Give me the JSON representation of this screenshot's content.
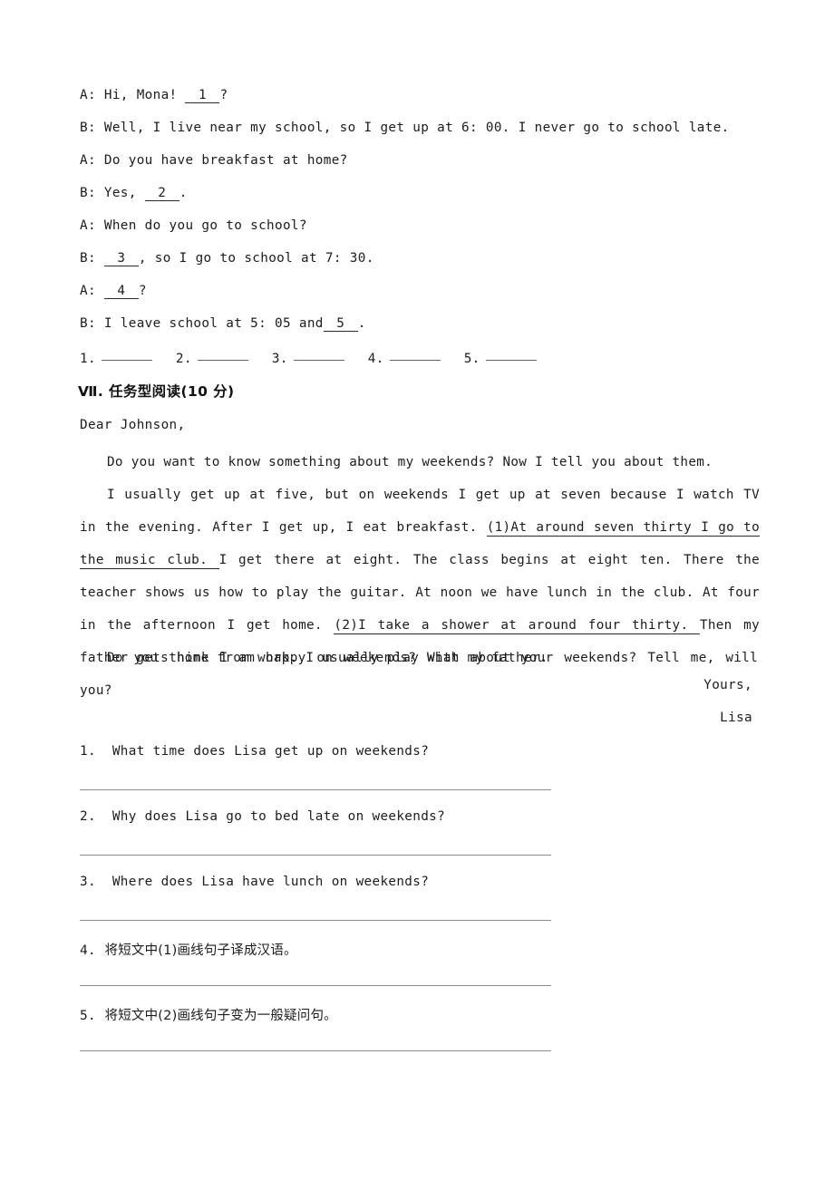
{
  "document": {
    "dialogue": {
      "lines": [
        {
          "speaker": "A:",
          "pre": "Hi, Mona! ",
          "blank": "1",
          "post": "?"
        },
        {
          "speaker": "B:",
          "pre": "Well, I live near my school, so I get up at 6: 00. I never go to school late.",
          "blank": "",
          "post": ""
        },
        {
          "speaker": "A:",
          "pre": "Do you have breakfast at home?",
          "blank": "",
          "post": ""
        },
        {
          "speaker": "B:",
          "pre": "Yes, ",
          "blank": "2",
          "post": "."
        },
        {
          "speaker": "A:",
          "pre": "When do you go to school?",
          "blank": "",
          "post": ""
        },
        {
          "speaker": "B:",
          "pre": " ",
          "blank": "3",
          "post": ", so I go to school at 7: 30."
        },
        {
          "speaker": "A:",
          "pre": " ",
          "blank": "4",
          "post": "?"
        },
        {
          "speaker": "B:",
          "pre": "I leave school at 5: 05 and",
          "blank": "5",
          "post": "."
        }
      ],
      "answer_slots": [
        "1.",
        "2.",
        "3.",
        "4.",
        "5."
      ]
    },
    "section": {
      "heading": "Ⅶ. 任务型阅读(10 分)",
      "salutation": "Dear Johnson,",
      "paragraph1": "Do you want to know something about my weekends? Now I tell you about them.",
      "paragraph2_a": "I usually get up at five, but on weekends I get up at seven because I watch TV in the evening. After I get up, I eat breakfast. ",
      "paragraph2_underline1": "(1)At around seven thirty I go to the music club. ",
      "paragraph2_b": "I get there at eight. The class begins at eight ten. There the teacher shows us how to play the guitar. At noon we have lunch in the club. At four in the afternoon I get home. ",
      "paragraph2_underline2": "(2)I take a shower at around four thirty. ",
      "paragraph2_c": "Then my father gets home from work. I usually play with my father.",
      "paragraph3": "Do you think I am happy on weekends? What about your weekends? Tell me, will you?",
      "closing": "Yours,",
      "signer": "Lisa",
      "questions": [
        {
          "num": "1.",
          "text": "What time does Lisa get up on weekends?",
          "lang": "en"
        },
        {
          "num": "2.",
          "text": "Why does Lisa go to bed late on weekends?",
          "lang": "en"
        },
        {
          "num": "3.",
          "text": "Where does Lisa have lunch on weekends?",
          "lang": "en"
        },
        {
          "num": "4.",
          "text": "将短文中(1)画线句子译成汉语。",
          "lang": "cn"
        },
        {
          "num": "5.",
          "text": "将短文中(2)画线句子变为一般疑问句。",
          "lang": "cn"
        }
      ]
    }
  }
}
